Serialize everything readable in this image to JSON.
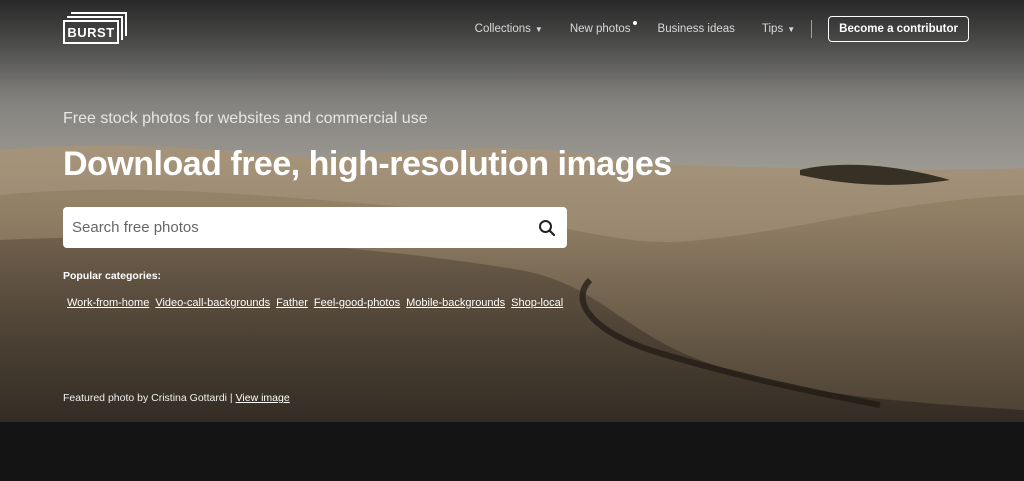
{
  "header": {
    "logo_text": "BURST",
    "nav": [
      {
        "label": "Collections",
        "has_caret": true
      },
      {
        "label": "New photos",
        "has_dot": true
      },
      {
        "label": "Business ideas"
      },
      {
        "label": "Tips",
        "has_caret": true
      }
    ],
    "contribute_label": "Become a contributor"
  },
  "hero": {
    "subtitle": "Free stock photos for websites and commercial use",
    "headline": "Download free, high-resolution images",
    "search": {
      "placeholder": "Search free photos",
      "value": ""
    },
    "popular_label": "Popular categories:",
    "categories": [
      "Work-from-home",
      "Video-call-backgrounds",
      "Father",
      "Feel-good-photos",
      "Mobile-backgrounds",
      "Shop-local"
    ],
    "credit_text": "Featured photo by Cristina Gottardi |",
    "credit_link": "View image"
  },
  "colors": {
    "footer_bg": "#141414",
    "text": "#ffffff"
  },
  "icons": {
    "search": "search-icon",
    "caret": "caret-down-icon"
  }
}
